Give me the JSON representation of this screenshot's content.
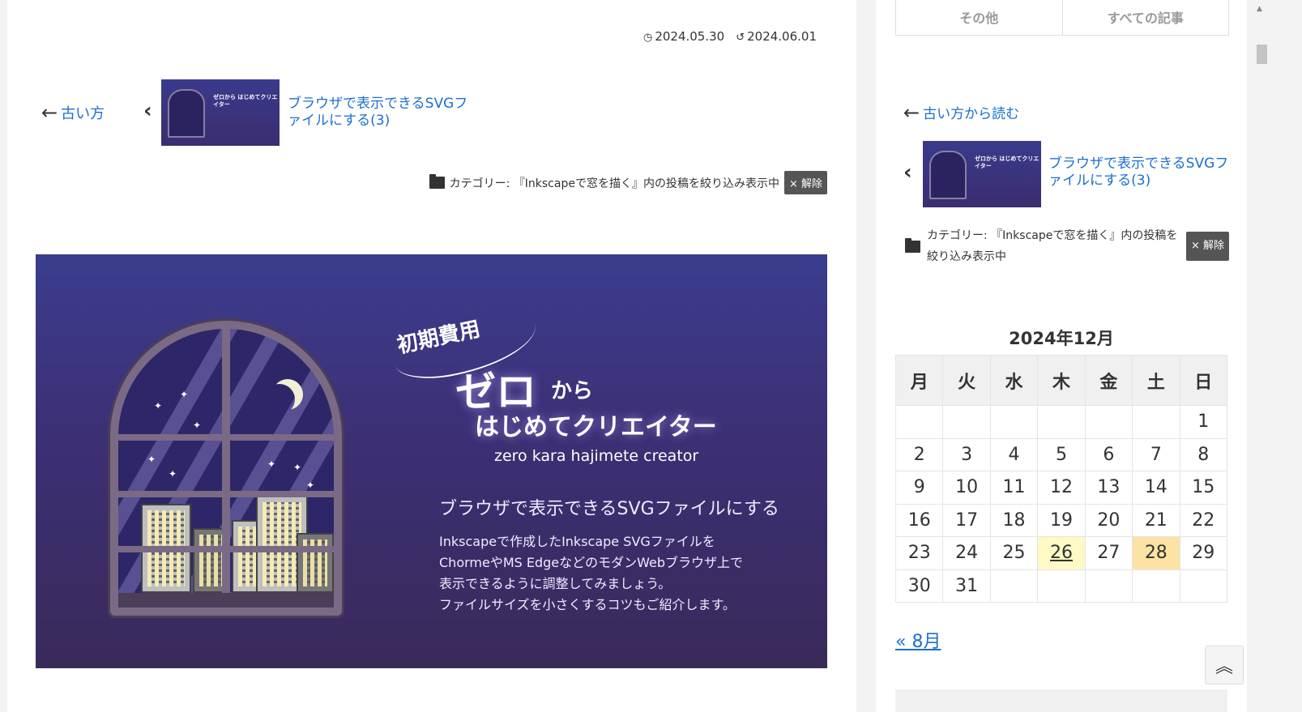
{
  "post_meta": {
    "published_icon": "clock-icon",
    "published": "2024.05.30",
    "updated_icon": "refresh-icon",
    "updated": "2024.06.01"
  },
  "prev_nav": {
    "old_label": "古い方",
    "post_title": "ブラウザで表示できるSVGファイルにする(3)"
  },
  "category_filter": {
    "text": "カテゴリー: 『Inkscapeで窓を描く』内の投稿を絞り込み表示中",
    "unset_label": "× 解除"
  },
  "hero": {
    "kicker": "初期費用",
    "zero": "ゼロ",
    "kara": "から",
    "hajimete": "はじめてクリエイター",
    "roman": "zero kara hajimete creator",
    "subtitle": "ブラウザで表示できるSVGファイルにする",
    "desc_lines": [
      "Inkscapeで作成したInkscape SVGファイルを",
      "ChormeやMS EdgeなどのモダンWebブラウザ上で",
      "表示できるように調整してみましょう。",
      "ファイルサイズを小さくするコツもご紹介します。"
    ]
  },
  "thumb": {
    "title": "ゼロから はじめてクリエイター"
  },
  "sidebar": {
    "tabs": [
      "その他",
      "すべての記事"
    ],
    "old_label": "古い方から読む",
    "post_title": "ブラウザで表示できるSVGファイルにする(3)",
    "category_text": "カテゴリー: 『Inkscapeで窓を描く』内の投稿を絞り込み表示中",
    "unset_label": "× 解除"
  },
  "calendar": {
    "caption": "2024年12月",
    "weekdays": [
      "月",
      "火",
      "水",
      "木",
      "金",
      "土",
      "日"
    ],
    "weeks": [
      [
        "",
        "",
        "",
        "",
        "",
        "",
        "1"
      ],
      [
        "2",
        "3",
        "4",
        "5",
        "6",
        "7",
        "8"
      ],
      [
        "9",
        "10",
        "11",
        "12",
        "13",
        "14",
        "15"
      ],
      [
        "16",
        "17",
        "18",
        "19",
        "20",
        "21",
        "22"
      ],
      [
        "23",
        "24",
        "25",
        "26",
        "27",
        "28",
        "29"
      ],
      [
        "30",
        "31",
        "",
        "",
        "",
        "",
        ""
      ]
    ],
    "linked_day": "26",
    "today": "28",
    "prev_link": "« 8月"
  },
  "colors": {
    "link": "#1a6fd0",
    "hero_top": "#3b3d8e",
    "hero_bottom": "#3a2a5a",
    "calendar_post": "#fff9c6",
    "calendar_today": "#fce3a3"
  }
}
